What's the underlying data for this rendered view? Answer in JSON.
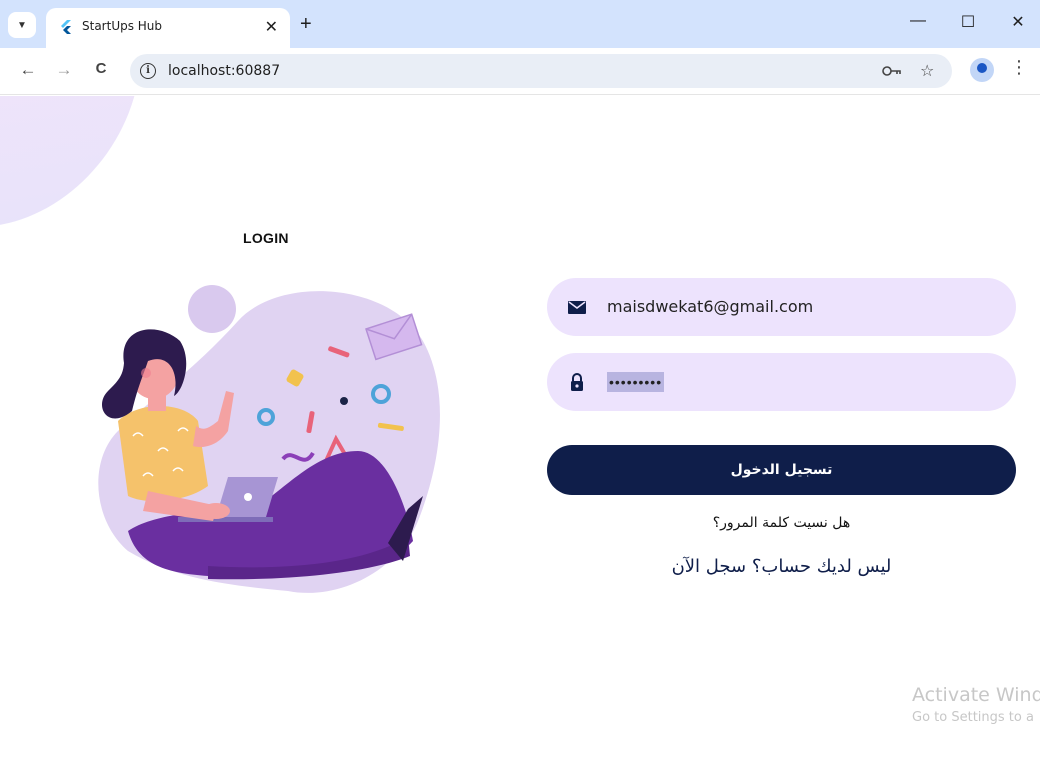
{
  "browser": {
    "tab_title": "StartUps Hub",
    "tab_close": "✕",
    "new_tab": "+",
    "url": "localhost:60887",
    "window_controls": {
      "minimize": "—",
      "maximize": "☐",
      "close": "✕"
    },
    "nav": {
      "back": "←",
      "forward": "→",
      "reload": "C"
    }
  },
  "login": {
    "title": "LOGIN",
    "email": {
      "value": "maisdwekat6@gmail.com",
      "icon": "mail-icon"
    },
    "password": {
      "value": "•••••••••",
      "icon": "lock-icon"
    },
    "submit_label": "تسجيل الدخول",
    "forgot_label": "هل نسيت كلمة المرور؟",
    "signup_label": "ليس لديك حساب؟ سجل الآن"
  },
  "windows_watermark": {
    "title": "Activate Wind",
    "subtitle": "Go to Settings to a"
  },
  "colors": {
    "primary": "#0f1e4a",
    "field_bg": "#ede3fd",
    "browser_frame": "#d3e3fd"
  }
}
